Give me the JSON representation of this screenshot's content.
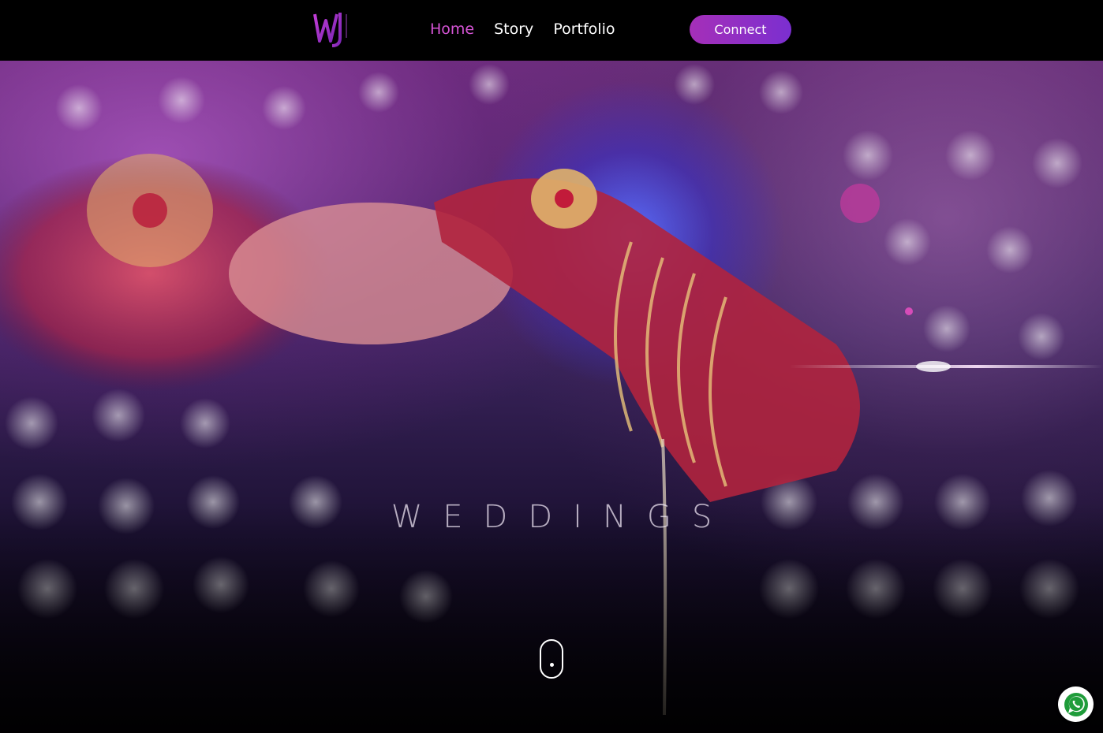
{
  "header": {
    "logo": {
      "icon": "wj-monogram-logo",
      "color": "#b82fc8"
    },
    "nav": [
      {
        "label": "Home",
        "active": true
      },
      {
        "label": "Story",
        "active": false
      },
      {
        "label": "Portfolio",
        "active": false
      }
    ],
    "connect_label": "Connect"
  },
  "hero": {
    "title": "WEDDINGS",
    "scroll_icon": "mouse-scroll-icon"
  },
  "floating": {
    "whatsapp_icon": "whatsapp-icon"
  },
  "colors": {
    "accent": "#d654d6",
    "button_start": "#a52fb8",
    "button_end": "#7b2fd0",
    "header_bg": "#000000"
  }
}
